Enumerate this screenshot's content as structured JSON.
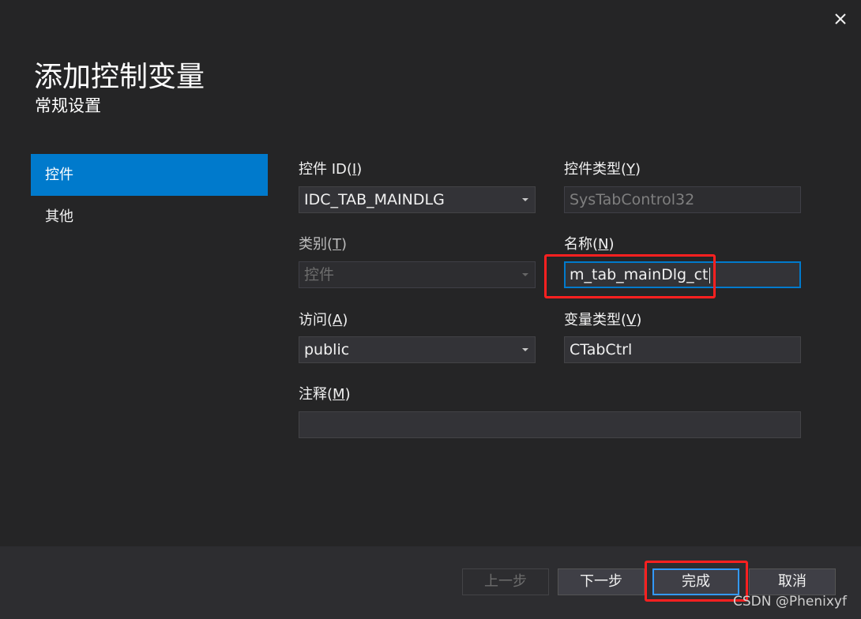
{
  "dialog": {
    "title": "添加控制变量",
    "subtitle": "常规设置",
    "close_glyph": "✕"
  },
  "nav": {
    "items": [
      {
        "label": "控件",
        "active": true
      },
      {
        "label": "其他",
        "active": false
      }
    ]
  },
  "form": {
    "control_id": {
      "label": "控件 ID(",
      "key": "I",
      "suffix": ")",
      "value": "IDC_TAB_MAINDLG"
    },
    "control_type": {
      "label": "控件类型(",
      "key": "Y",
      "suffix": ")",
      "value": "SysTabControl32"
    },
    "category": {
      "label": "类别(",
      "key": "T",
      "suffix": ")",
      "value": "控件"
    },
    "name": {
      "label": "名称(",
      "key": "N",
      "suffix": ")",
      "value": "m_tab_mainDlg_ct"
    },
    "access": {
      "label": "访问(",
      "key": "A",
      "suffix": ")",
      "value": "public"
    },
    "variable_type": {
      "label": "变量类型(",
      "key": "V",
      "suffix": ")",
      "value": "CTabCtrl"
    },
    "comment": {
      "label": "注释(",
      "key": "M",
      "suffix": ")",
      "value": ""
    }
  },
  "footer": {
    "prev_label": "上一步",
    "next_label": "下一步",
    "finish_label": "完成",
    "cancel_label": "取消"
  },
  "watermark": "CSDN @Phenixyf",
  "colors": {
    "accent": "#007acc",
    "highlight": "#ff2020",
    "background": "#252526"
  }
}
